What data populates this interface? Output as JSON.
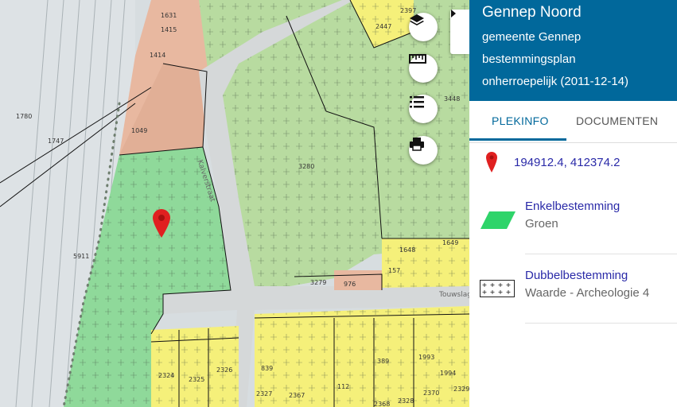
{
  "map": {
    "parcels": [
      "1631",
      "1415",
      "1414",
      "1780",
      "1747",
      "1049",
      "5911",
      "3280",
      "3448",
      "2397",
      "2447",
      "1649",
      "1648",
      "157",
      "976",
      "3279",
      "839",
      "389",
      "1993",
      "1994",
      "2324",
      "2325",
      "2326",
      "2327",
      "2367",
      "112",
      "2328",
      "2370",
      "2329",
      "2368"
    ],
    "streets": [
      "Kalverstraat",
      "Touwslagersbaan"
    ],
    "tools": {
      "layers_icon": "layers-icon",
      "measure_icon": "ruler-icon",
      "legend_icon": "list-icon",
      "print_icon": "printer-icon"
    },
    "marker_icon": "map-pin-icon"
  },
  "panel": {
    "title": "Gennep Noord",
    "subtitle_line1": "gemeente Gennep",
    "subtitle_line2": "bestemmingsplan",
    "subtitle_line3": "onherroepelijk (2011-12-14)",
    "tabs": [
      {
        "label": "PLEKINFO",
        "active": true
      },
      {
        "label": "DOCUMENTEN",
        "active": false
      }
    ],
    "coordinates": "194912.4, 412374.2",
    "items": [
      {
        "title": "Enkelbestemming",
        "subtitle": "Groen",
        "swatch": "#2fd46a"
      },
      {
        "title": "Dubbelbestemming",
        "subtitle": "Waarde - Archeologie 4"
      }
    ]
  },
  "colors": {
    "header": "#01689b",
    "link": "#2a2aa8",
    "groen": "#2fd46a",
    "marker": "#e02020"
  }
}
